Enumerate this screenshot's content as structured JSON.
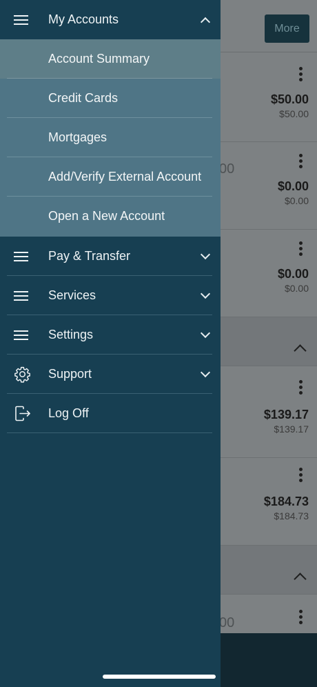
{
  "background": {
    "more_button": "More",
    "rows": [
      {
        "amount": "$50.00",
        "sub_amount": "$50.00"
      },
      {
        "ghost_text": "00",
        "amount": "$0.00",
        "sub_amount": "$0.00"
      },
      {
        "amount": "$0.00",
        "sub_amount": "$0.00"
      },
      {
        "amount": "$139.17",
        "sub_amount": "$139.17"
      },
      {
        "amount": "$184.73",
        "sub_amount": "$184.73"
      },
      {
        "ghost_text": "00"
      }
    ]
  },
  "drawer": {
    "my_accounts": {
      "label": "My Accounts",
      "icon": "hamburger-icon",
      "expanded": true,
      "items": [
        {
          "label": "Account Summary",
          "active": true
        },
        {
          "label": "Credit Cards"
        },
        {
          "label": "Mortgages"
        },
        {
          "label": "Add/Verify External Account"
        },
        {
          "label": "Open a New Account"
        }
      ]
    },
    "menu": [
      {
        "label": "Pay & Transfer",
        "icon": "hamburger-icon",
        "expandable": true
      },
      {
        "label": "Services",
        "icon": "hamburger-icon",
        "expandable": true
      },
      {
        "label": "Settings",
        "icon": "hamburger-icon",
        "expandable": true
      },
      {
        "label": "Support",
        "icon": "gear-icon",
        "expandable": true
      },
      {
        "label": "Log Off",
        "icon": "log-off-icon",
        "expandable": false
      }
    ]
  },
  "colors": {
    "drawer_bg": "#173f52",
    "submenu_bg": "#4f7586",
    "submenu_active_bg": "#5e7e88",
    "overlay_bg": "#7d8183"
  }
}
